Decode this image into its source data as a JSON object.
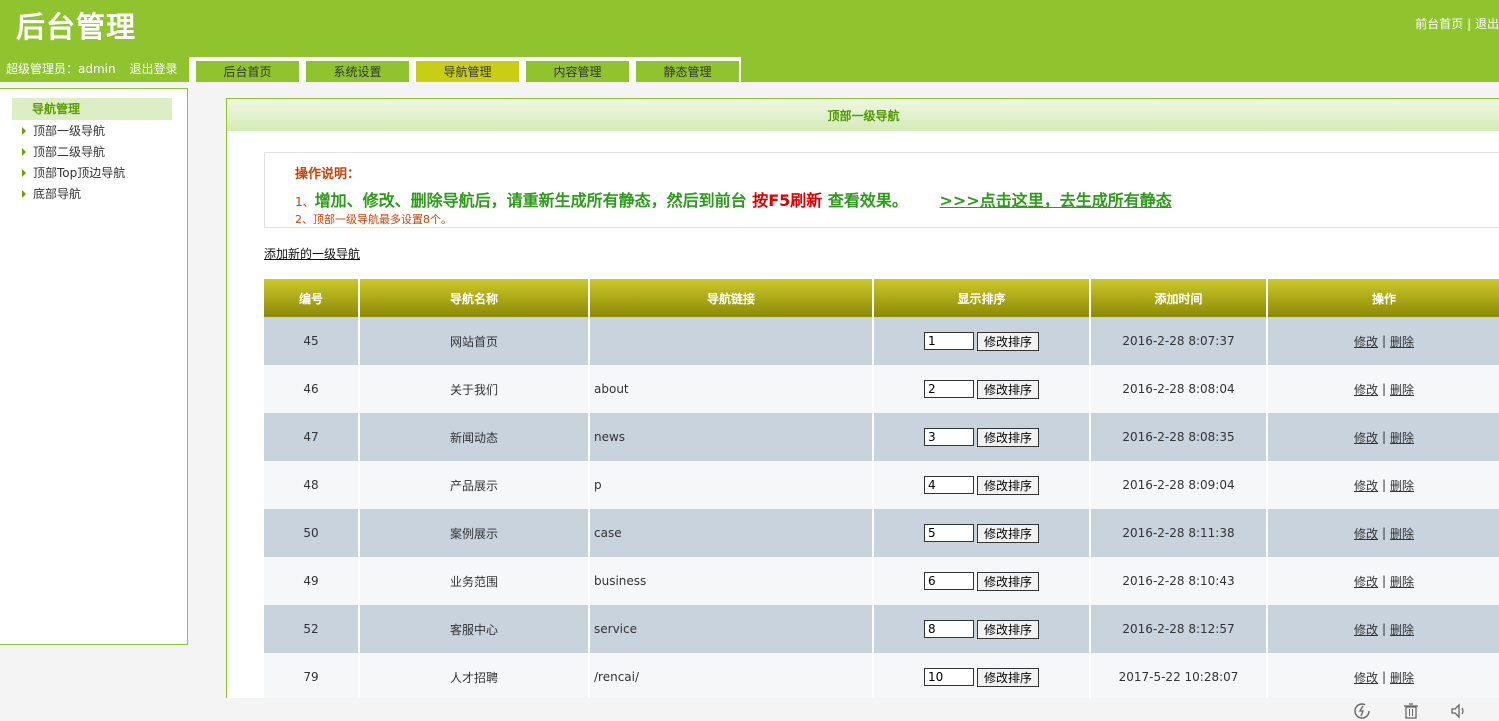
{
  "header": {
    "logo": "后台管理",
    "top_links": [
      "前台首页",
      "退出"
    ],
    "admin_label": "超级管理员：admin",
    "logout": "退出登录",
    "tabs": [
      {
        "label": "后台首页",
        "active": false
      },
      {
        "label": "系统设置",
        "active": false
      },
      {
        "label": "导航管理",
        "active": true
      },
      {
        "label": "内容管理",
        "active": false
      },
      {
        "label": "静态管理",
        "active": false
      }
    ]
  },
  "sidebar": {
    "title": "导航管理",
    "items": [
      {
        "label": "顶部一级导航"
      },
      {
        "label": "顶部二级导航"
      },
      {
        "label": "顶部Top顶边导航"
      },
      {
        "label": "底部导航"
      }
    ]
  },
  "main": {
    "title": "顶部一级导航",
    "notes": {
      "title": "操作说明：",
      "note1_num": "1、",
      "note1_text": "增加、修改、删除导航后，请重新生成所有静态，然后到前台",
      "note1_red": "按F5刷新",
      "note1_tail": "查看效果。",
      "note1_link": ">>>点击这里，去生成所有静态",
      "note2": "2、顶部一级导航最多设置8个。"
    },
    "add_link": "添加新的一级导航",
    "table": {
      "headers": [
        "编号",
        "导航名称",
        "导航链接",
        "显示排序",
        "添加时间",
        "操作"
      ],
      "sort_button": "修改排序",
      "edit_label": "修改",
      "delete_label": "删除",
      "separator": "|",
      "rows": [
        {
          "id": "45",
          "name": "网站首页",
          "link": "",
          "sort": "1",
          "time": "2016-2-28 8:07:37"
        },
        {
          "id": "46",
          "name": "关于我们",
          "link": "about",
          "sort": "2",
          "time": "2016-2-28 8:08:04"
        },
        {
          "id": "47",
          "name": "新闻动态",
          "link": "news",
          "sort": "3",
          "time": "2016-2-28 8:08:35"
        },
        {
          "id": "48",
          "name": "产品展示",
          "link": "p",
          "sort": "4",
          "time": "2016-2-28 8:09:04"
        },
        {
          "id": "50",
          "name": "案例展示",
          "link": "case",
          "sort": "5",
          "time": "2016-2-28 8:11:38"
        },
        {
          "id": "49",
          "name": "业务范围",
          "link": "business",
          "sort": "6",
          "time": "2016-2-28 8:10:43"
        },
        {
          "id": "52",
          "name": "客服中心",
          "link": "service",
          "sort": "8",
          "time": "2016-2-28 8:12:57"
        },
        {
          "id": "79",
          "name": "人才招聘",
          "link": "/rencai/",
          "sort": "10",
          "time": "2017-5-22 10:28:07"
        }
      ]
    }
  },
  "bottom_icons": [
    "refresh-icon",
    "trash-icon",
    "speaker-icon"
  ],
  "colors": {
    "brand_green": "#8fc42f",
    "active_tab": "#c9cd13",
    "header_olive": "#a3a512",
    "row_blue": "#c8d3de"
  }
}
